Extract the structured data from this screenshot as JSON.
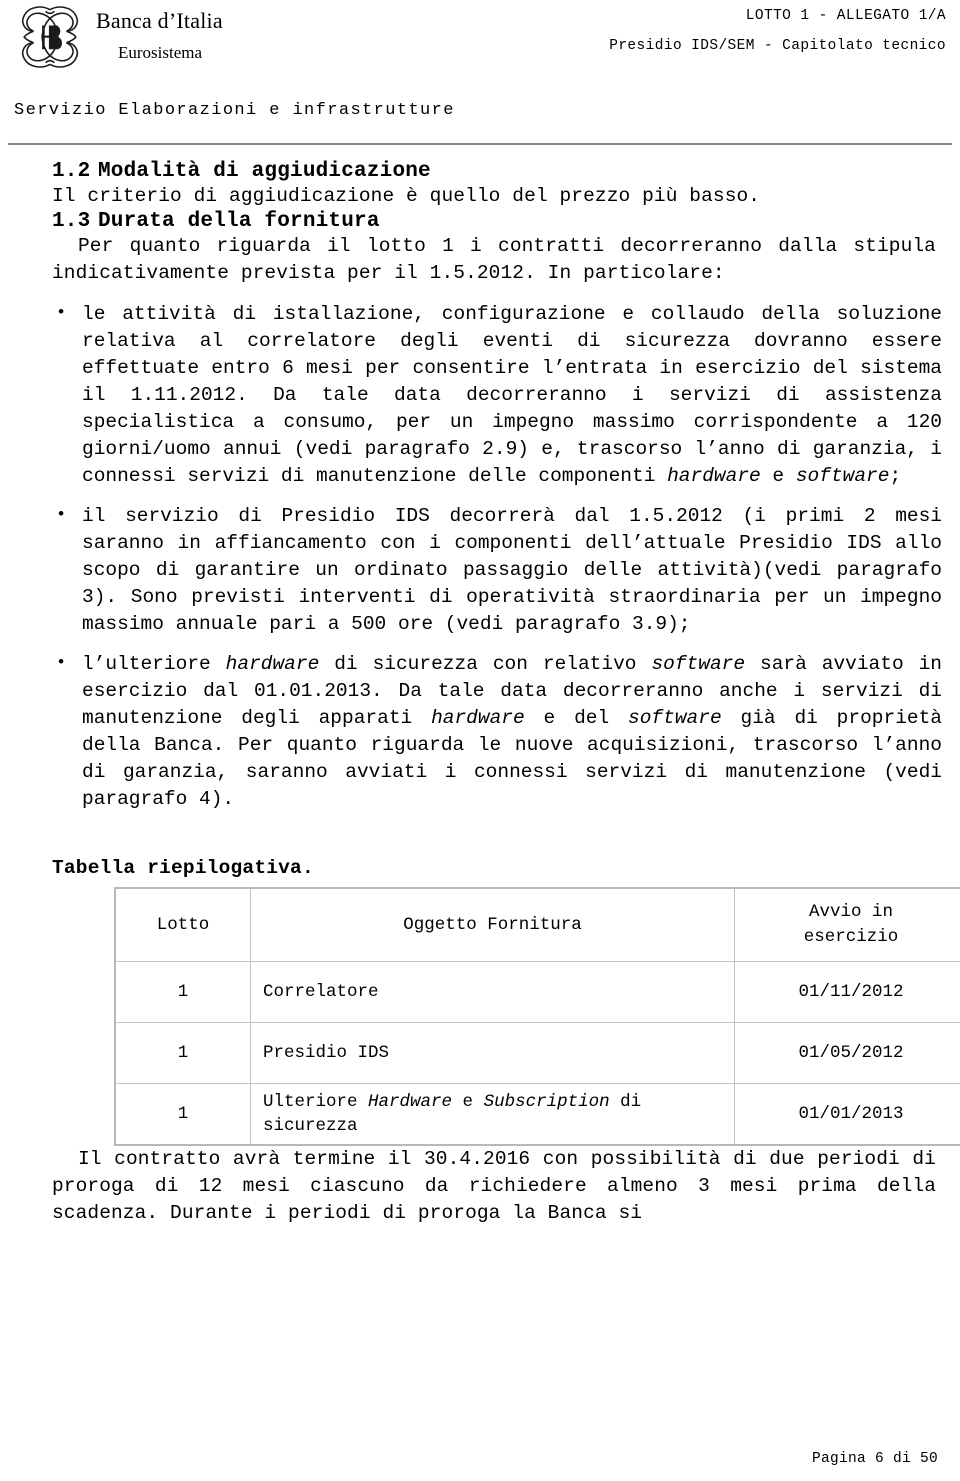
{
  "header": {
    "logo_icon": "banca-ditalia-monogram",
    "brand_title": "Banca d’Italia",
    "brand_subtitle": "Eurosistema",
    "lotto_line": "LOTTO 1 - ALLEGATO 1/A",
    "capitolato_line": "Presidio IDS/SEM - Capitolato tecnico",
    "service_line": "Servizio Elaborazioni e infrastrutture"
  },
  "sections": {
    "s12_number": "1.2",
    "s12_title": "Modalità di aggiudicazione",
    "s12_paragraph": "Il criterio di aggiudicazione è quello del prezzo più basso.",
    "s13_number": "1.3",
    "s13_title": "Durata della fornitura",
    "s13_intro": "Per quanto riguarda il lotto 1 i contratti decorreranno dalla stipula indicativamente prevista per il 1.5.2012. In particolare:"
  },
  "bullets": [
    {
      "p1": "le attività di istallazione, configurazione e collaudo della soluzione relativa al correlatore degli eventi di sicurezza dovranno essere effettuate entro 6 mesi per consentire l’entrata in esercizio del sistema il 1.11.2012. Da tale data decorreranno i servizi di assistenza specialistica a consumo, per un impegno massimo corrispondente a 120 giorni/uomo annui (vedi paragrafo 2.9) e, trascorso l’anno di garanzia, i connessi servizi di manutenzione delle componenti ",
      "i1": "hardware",
      "p2": " e ",
      "i2": "software",
      "p3": ";"
    },
    {
      "p1": "il servizio di Presidio IDS decorrerà dal 1.5.2012 (i primi 2 mesi saranno in affiancamento con i componenti dell’attuale Presidio IDS allo scopo di garantire un ordinato passaggio delle attività)(vedi paragrafo 3). Sono previsti interventi di operatività straordinaria per un impegno massimo annuale pari a 500 ore (vedi paragrafo 3.9);"
    },
    {
      "p1": "l’ulteriore ",
      "i1": "hardware",
      "p2": " di sicurezza con relativo ",
      "i2": "software",
      "p3": " sarà avviato in esercizio dal 01.01.2013. Da tale data decorreranno anche i servizi di manutenzione degli apparati ",
      "i3": "hardware",
      "p4": " e del ",
      "i4": "software",
      "p5": " già di proprietà della Banca. Per quanto riguarda le nuove acquisizioni, trascorso l’anno di garanzia, saranno avviati i connessi servizi di manutenzione (vedi paragrafo 4)."
    }
  ],
  "table": {
    "caption": "Tabella riepilogativa.",
    "columns": [
      "Lotto",
      "Oggetto Fornitura",
      "Avvio in esercizio"
    ],
    "header_avvio_line1": "Avvio in",
    "header_avvio_line2": "esercizio",
    "rows": [
      {
        "lotto": "1",
        "oggetto": "Correlatore",
        "avvio": "01/11/2012"
      },
      {
        "lotto": "1",
        "oggetto": "Presidio IDS",
        "avvio": "01/05/2012"
      },
      {
        "lotto": "1",
        "oggetto_p1": "Ulteriore ",
        "oggetto_i1": "Hardware",
        "oggetto_p2": " e ",
        "oggetto_i2": "Subscription",
        "oggetto_p3": " di sicurezza",
        "avvio": "01/01/2013"
      }
    ]
  },
  "closing_paragraph": "Il contratto avrà termine il 30.4.2016 con possibilità di due periodi di proroga di 12 mesi ciascuno da richiedere almeno 3 mesi prima della scadenza. Durante i periodi di proroga la Banca si",
  "footer": {
    "page_label": "Pagina 6 di 50"
  }
}
